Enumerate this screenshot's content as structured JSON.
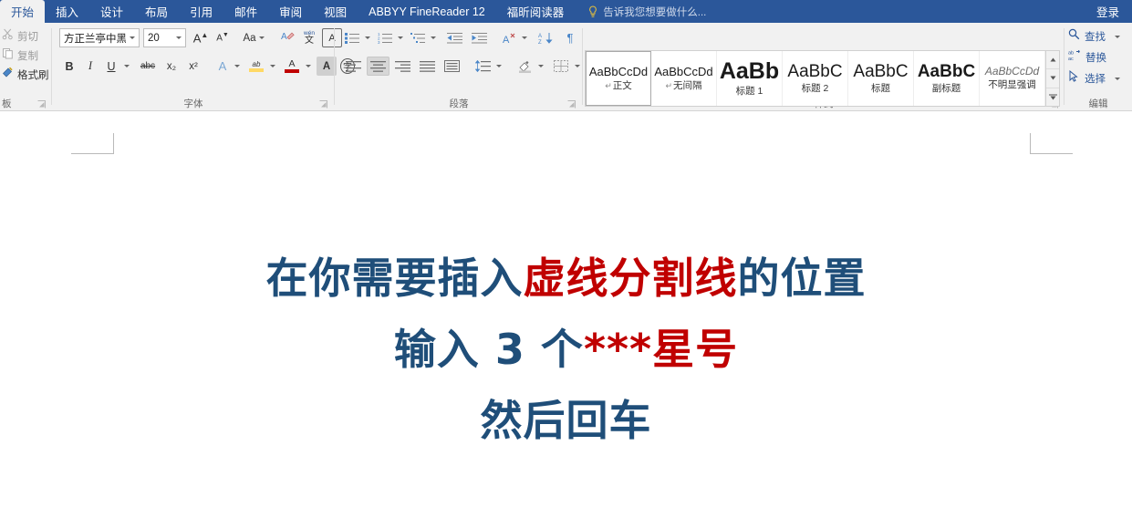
{
  "window": {
    "tabs": [
      {
        "label": "开始",
        "active": true
      },
      {
        "label": "插入",
        "active": false
      },
      {
        "label": "设计",
        "active": false
      },
      {
        "label": "布局",
        "active": false
      },
      {
        "label": "引用",
        "active": false
      },
      {
        "label": "邮件",
        "active": false
      },
      {
        "label": "审阅",
        "active": false
      },
      {
        "label": "视图",
        "active": false
      },
      {
        "label": "ABBYY FineReader 12",
        "active": false
      },
      {
        "label": "福昕阅读器",
        "active": false
      }
    ],
    "tell_me": "告诉我您想要做什么...",
    "tell_me_icon": "lightbulb-icon",
    "sign_in": "登录",
    "accent_color": "#2b579a"
  },
  "ribbon": {
    "clipboard": {
      "group_label": "板",
      "items": [
        {
          "label": "剪切",
          "icon": "scissors-icon",
          "enabled": false
        },
        {
          "label": "复制",
          "icon": "copy-icon",
          "enabled": false
        },
        {
          "label": "格式刷",
          "icon": "format-painter-icon",
          "enabled": true
        }
      ]
    },
    "font": {
      "group_label": "字体",
      "font_name": "方正兰亭中黑",
      "font_size": "20",
      "row1": [
        {
          "name": "grow-font-icon",
          "glyph": "A"
        },
        {
          "name": "shrink-font-icon",
          "glyph": "A"
        },
        {
          "name": "change-case-icon",
          "glyph": "Aa"
        },
        {
          "name": "clear-formatting-icon",
          "glyph": "A"
        },
        {
          "name": "phonetic-guide-icon",
          "glyph": "文"
        },
        {
          "name": "character-border-icon",
          "glyph": "A"
        }
      ],
      "row2": [
        {
          "name": "bold-icon",
          "glyph": "B"
        },
        {
          "name": "italic-icon",
          "glyph": "I"
        },
        {
          "name": "underline-icon",
          "glyph": "U"
        },
        {
          "name": "strikethrough-icon",
          "glyph": "abc"
        },
        {
          "name": "subscript-icon",
          "glyph": "x₂"
        },
        {
          "name": "superscript-icon",
          "glyph": "x²"
        },
        {
          "name": "text-effects-icon",
          "glyph": "A"
        },
        {
          "name": "text-highlight-icon",
          "glyph": "ab"
        },
        {
          "name": "font-color-icon",
          "glyph": "A"
        },
        {
          "name": "character-shading-icon",
          "glyph": "A"
        },
        {
          "name": "enclose-characters-icon",
          "glyph": "字"
        }
      ]
    },
    "paragraph": {
      "group_label": "段落",
      "row1": [
        {
          "name": "bullets-icon"
        },
        {
          "name": "numbering-icon"
        },
        {
          "name": "multilevel-list-icon"
        },
        {
          "name": "decrease-indent-icon"
        },
        {
          "name": "increase-indent-icon"
        },
        {
          "name": "asian-layout-icon"
        },
        {
          "name": "sort-icon"
        },
        {
          "name": "show-formatting-marks-icon"
        }
      ],
      "row2": [
        {
          "name": "align-left-icon",
          "active": false
        },
        {
          "name": "align-center-icon",
          "active": true
        },
        {
          "name": "align-right-icon",
          "active": false
        },
        {
          "name": "justify-icon",
          "active": false
        },
        {
          "name": "distribute-icon",
          "active": false
        },
        {
          "name": "line-spacing-icon",
          "active": false
        },
        {
          "name": "shading-icon",
          "active": false
        },
        {
          "name": "borders-icon",
          "active": false
        }
      ]
    },
    "styles": {
      "group_label": "样式",
      "items": [
        {
          "preview": "AaBbCcDd",
          "name": "正文",
          "selected": true,
          "pilcrow": true,
          "size": 13,
          "weight": "normal",
          "italic": false,
          "color": "#1a1a1a"
        },
        {
          "preview": "AaBbCcDd",
          "name": "无间隔",
          "selected": false,
          "pilcrow": true,
          "size": 13,
          "weight": "normal",
          "italic": false,
          "color": "#1a1a1a"
        },
        {
          "preview": "AaBb",
          "name": "标题 1",
          "selected": false,
          "pilcrow": false,
          "size": 25,
          "weight": "bold",
          "italic": false,
          "color": "#1a1a1a"
        },
        {
          "preview": "AaBbC",
          "name": "标题 2",
          "selected": false,
          "pilcrow": false,
          "size": 19,
          "weight": "normal",
          "italic": false,
          "color": "#1a1a1a"
        },
        {
          "preview": "AaBbC",
          "name": "标题",
          "selected": false,
          "pilcrow": false,
          "size": 19,
          "weight": "normal",
          "italic": false,
          "color": "#1a1a1a"
        },
        {
          "preview": "AaBbC",
          "name": "副标题",
          "selected": false,
          "pilcrow": false,
          "size": 19,
          "weight": "bold",
          "italic": false,
          "color": "#1a1a1a"
        },
        {
          "preview": "AaBbCcDd",
          "name": "不明显强调",
          "selected": false,
          "pilcrow": false,
          "size": 12,
          "weight": "normal",
          "italic": true,
          "color": "#6b6b6b"
        }
      ]
    },
    "editing": {
      "group_label": "编辑",
      "items": [
        {
          "label": "查找",
          "icon": "search-icon",
          "has_caret": true
        },
        {
          "label": "替换",
          "icon": "replace-icon",
          "has_caret": false
        },
        {
          "label": "选择",
          "icon": "select-icon",
          "has_caret": true
        }
      ]
    }
  },
  "document": {
    "text_navy_color": "#1f4e79",
    "text_red_color": "#c00000",
    "lines": [
      {
        "segments": [
          {
            "text": "在你需要插入",
            "color": "navy"
          },
          {
            "text": "虚线分割线",
            "color": "red"
          },
          {
            "text": "的位置",
            "color": "navy"
          }
        ]
      },
      {
        "segments": [
          {
            "text": "输入 3 个",
            "color": "navy"
          },
          {
            "text": "***星号",
            "color": "red"
          }
        ]
      },
      {
        "segments": [
          {
            "text": "然后回车",
            "color": "navy"
          }
        ]
      }
    ]
  }
}
